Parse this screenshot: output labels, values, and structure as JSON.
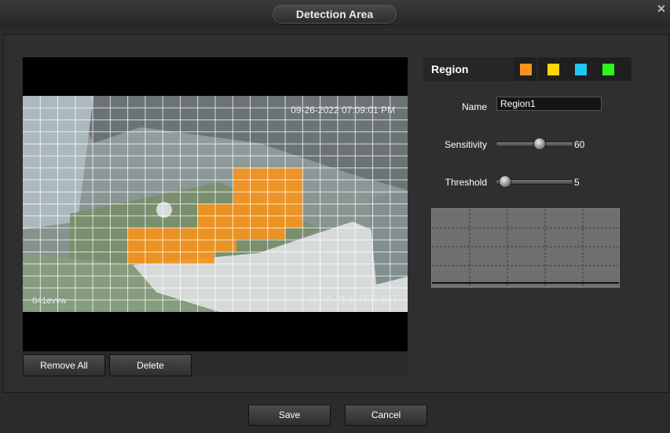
{
  "dialog": {
    "title": "Detection Area"
  },
  "video": {
    "timestamp": "09-26-2022 07:09:01 PM",
    "watermark": "AMCREST",
    "camera_label": "841evvw"
  },
  "buttons": {
    "remove_all": "Remove All",
    "delete": "Delete",
    "save": "Save",
    "cancel": "Cancel"
  },
  "region": {
    "label": "Region",
    "colors": [
      "#f7941d",
      "#ffd700",
      "#1ec8f0",
      "#2ef51a"
    ],
    "selected_color": "#f7941d"
  },
  "fields": {
    "name_label": "Name",
    "name_value": "Region1",
    "sensitivity_label": "Sensitivity",
    "sensitivity_value": "60",
    "threshold_label": "Threshold",
    "threshold_value": "5"
  },
  "icons": {
    "close": "close-icon",
    "logo": "amcrest-logo-icon"
  }
}
